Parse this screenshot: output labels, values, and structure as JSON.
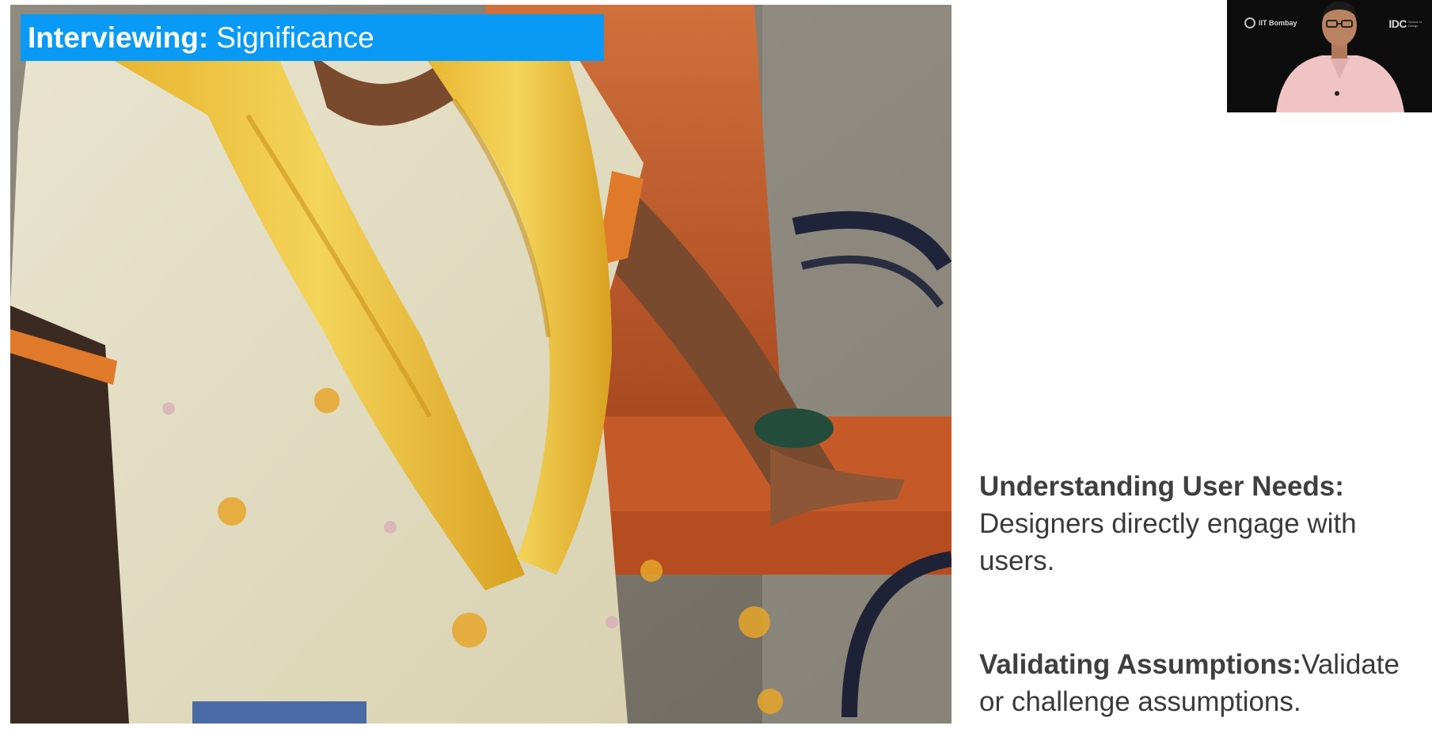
{
  "title": {
    "bold": "Interviewing:",
    "light": "Significance"
  },
  "points": [
    {
      "title": "Understanding User Needs:",
      "text": "Designers directly engage with users."
    },
    {
      "title": "Validating Assumptions:",
      "text": "Validate or challenge assumptions."
    }
  ],
  "presenter": {
    "logo_left": "IIT Bombay",
    "logo_right": "IDC",
    "logo_right_sub": "School of Design"
  },
  "colors": {
    "banner": "#0a9af5",
    "text": "#3a3a3a",
    "background": "#ffffff"
  },
  "icons": {
    "seal": "iit-bombay-seal-icon"
  }
}
